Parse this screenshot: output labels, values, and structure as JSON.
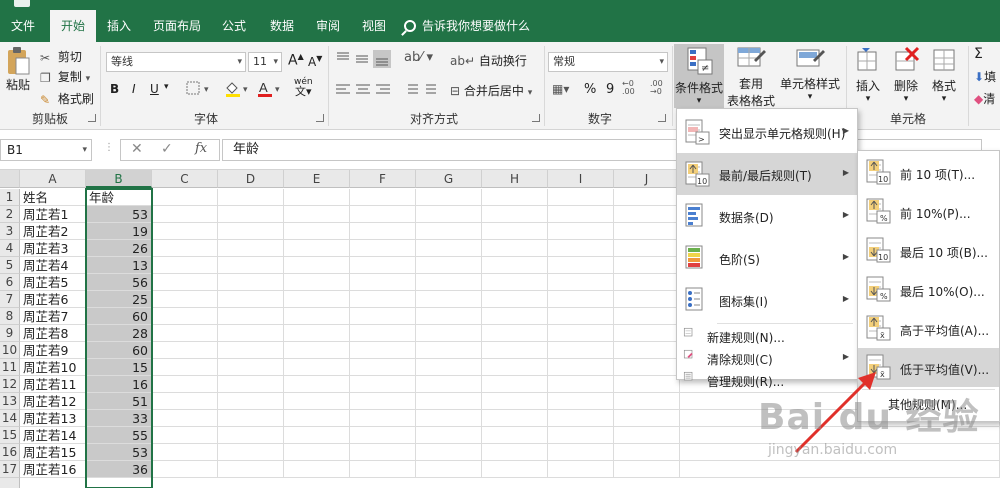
{
  "tabs": [
    "文件",
    "开始",
    "插入",
    "页面布局",
    "公式",
    "数据",
    "审阅",
    "视图"
  ],
  "active_tab": "开始",
  "tell_me": "告诉我你想要做什么",
  "ribbon": {
    "clipboard": {
      "paste": "粘贴",
      "cut": "剪切",
      "copy": "复制",
      "format_painter": "格式刷",
      "label": "剪贴板"
    },
    "font": {
      "name": "等线",
      "size": "11",
      "grow": "A",
      "shrink": "A",
      "bold": "B",
      "italic": "I",
      "underline": "U",
      "phonetic": "wén",
      "label": "字体"
    },
    "alignment": {
      "wrap": "自动换行",
      "merge": "合并后居中",
      "label": "对齐方式"
    },
    "number": {
      "format": "常规",
      "percent": "%",
      "comma": "9",
      "label": "数字"
    },
    "styles": {
      "conditional": "条件格式",
      "table_line1": "套用",
      "table_line2": "表格格式",
      "cell_styles": "单元格样式"
    },
    "cells": {
      "insert": "插入",
      "delete": "删除",
      "format": "格式",
      "label": "单元格"
    },
    "editing": {
      "sum": "Σ",
      "fill": "填",
      "clear": "清"
    }
  },
  "formula_bar": {
    "name_box": "B1",
    "cancel": "✕",
    "enter": "✓",
    "fx": "fx",
    "content": "年龄"
  },
  "columns": [
    "A",
    "B",
    "C",
    "D",
    "E",
    "F",
    "G",
    "H",
    "I",
    "J"
  ],
  "selected_column": "B",
  "rows": [
    {
      "n": "1",
      "a": "姓名",
      "b": ""
    },
    {
      "n": "2",
      "a": "周芷若1",
      "b": "53"
    },
    {
      "n": "3",
      "a": "周芷若2",
      "b": "19"
    },
    {
      "n": "4",
      "a": "周芷若3",
      "b": "26"
    },
    {
      "n": "5",
      "a": "周芷若4",
      "b": "13"
    },
    {
      "n": "6",
      "a": "周芷若5",
      "b": "56"
    },
    {
      "n": "7",
      "a": "周芷若6",
      "b": "25"
    },
    {
      "n": "8",
      "a": "周芷若7",
      "b": "60"
    },
    {
      "n": "9",
      "a": "周芷若8",
      "b": "28"
    },
    {
      "n": "10",
      "a": "周芷若9",
      "b": "60"
    },
    {
      "n": "11",
      "a": "周芷若10",
      "b": "15"
    },
    {
      "n": "12",
      "a": "周芷若11",
      "b": "16"
    },
    {
      "n": "13",
      "a": "周芷若12",
      "b": "51"
    },
    {
      "n": "14",
      "a": "周芷若13",
      "b": "33"
    },
    {
      "n": "15",
      "a": "周芷若14",
      "b": "55"
    },
    {
      "n": "16",
      "a": "周芷若15",
      "b": "53"
    },
    {
      "n": "17",
      "a": "周芷若16",
      "b": "36"
    }
  ],
  "header_b1": "年龄",
  "cf_menu": [
    {
      "label": "突出显示单元格规则(H)",
      "icon": "highlight-rules-icon",
      "sub": true
    },
    {
      "label": "最前/最后规则(T)",
      "icon": "top-bottom-rules-icon",
      "sub": true,
      "highlighted": true
    },
    {
      "label": "数据条(D)",
      "icon": "data-bars-icon",
      "sub": true
    },
    {
      "label": "色阶(S)",
      "icon": "color-scales-icon",
      "sub": true
    },
    {
      "label": "图标集(I)",
      "icon": "icon-sets-icon",
      "sub": true
    }
  ],
  "cf_menu_small": [
    {
      "label": "新建规则(N)...",
      "icon": "new-rule-icon"
    },
    {
      "label": "清除规则(C)",
      "icon": "clear-rules-icon",
      "sub": true
    },
    {
      "label": "管理规则(R)...",
      "icon": "manage-rules-icon"
    }
  ],
  "sub_menu": [
    {
      "label": "前 10 项(T)...",
      "icon": "top-10-items-icon"
    },
    {
      "label": "前 10%(P)...",
      "icon": "top-10-percent-icon"
    },
    {
      "label": "最后 10 项(B)...",
      "icon": "bottom-10-items-icon"
    },
    {
      "label": "最后 10%(O)...",
      "icon": "bottom-10-percent-icon"
    },
    {
      "label": "高于平均值(A)...",
      "icon": "above-average-icon"
    },
    {
      "label": "低于平均值(V)...",
      "icon": "below-average-icon",
      "highlighted": true
    }
  ],
  "sub_menu_more": "其他规则(M)...",
  "watermark": {
    "line1": "Bai du 经验",
    "line2": "jingyan.baidu.com"
  },
  "colors": {
    "excel_green": "#217346",
    "arrow_red": "#e0302a",
    "highlight": "#d6d6d6"
  }
}
